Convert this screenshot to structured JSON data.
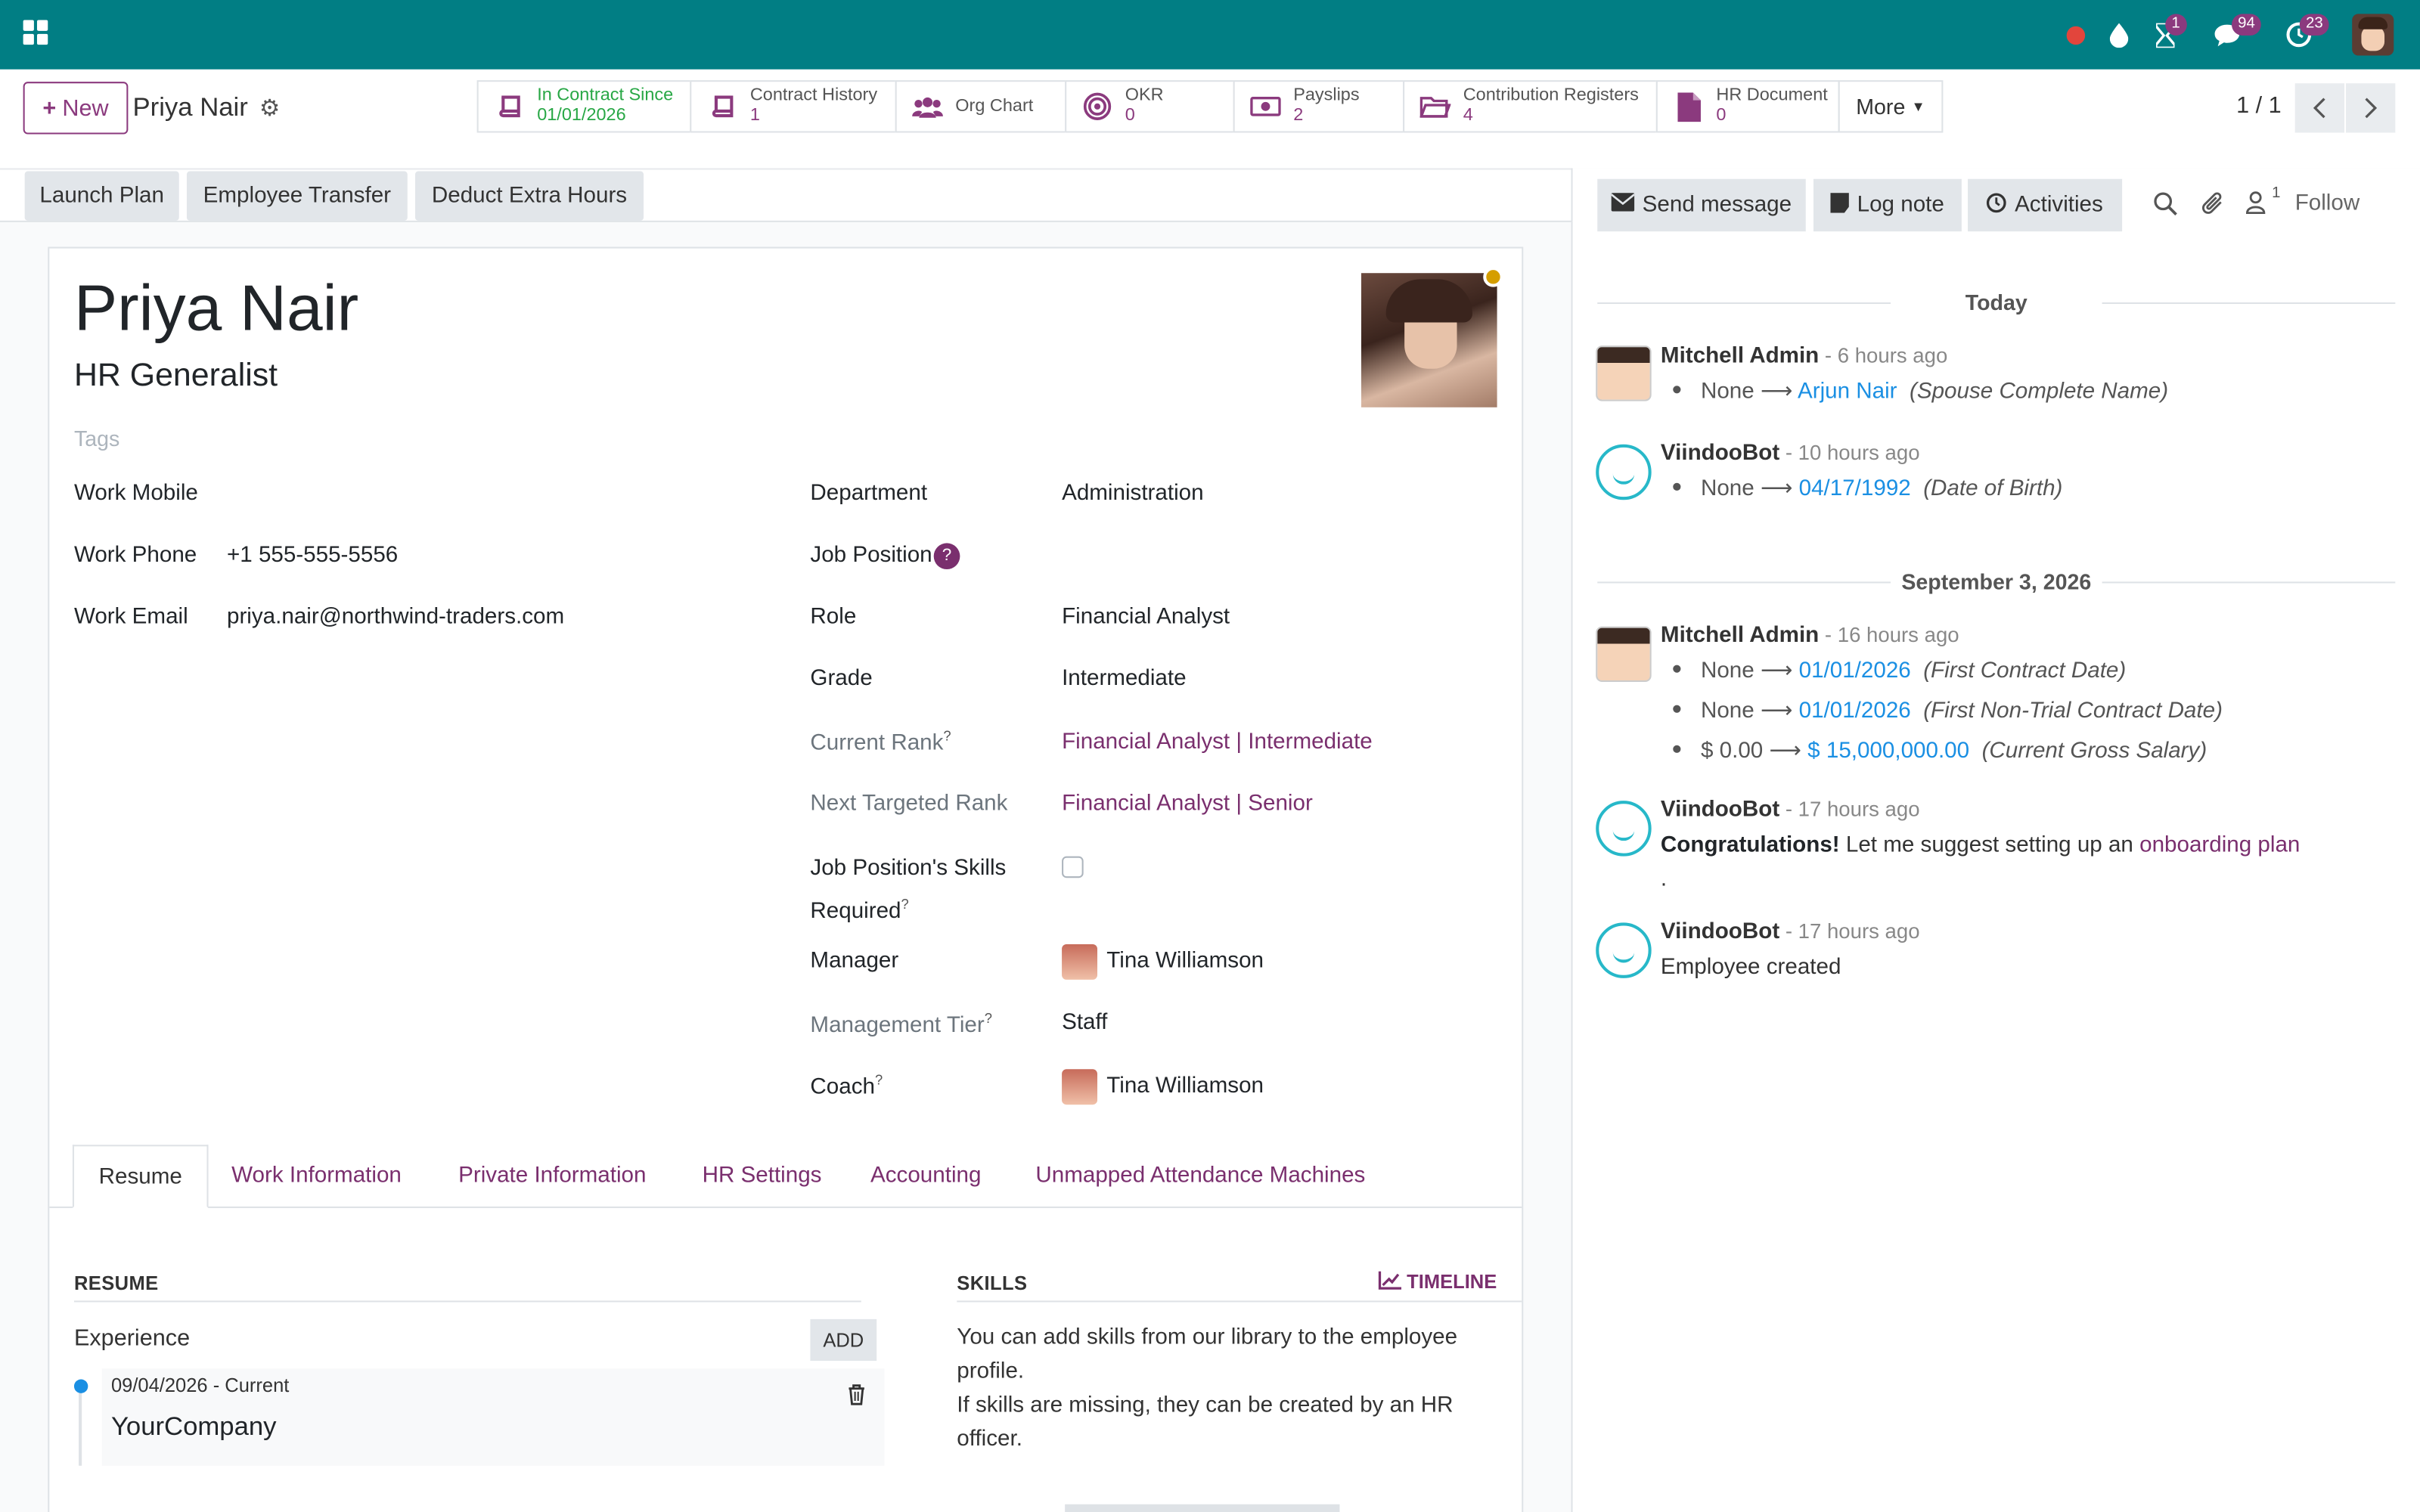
{
  "topbar": {
    "badges": {
      "activity": "1",
      "messages": "94",
      "clock": "23"
    }
  },
  "control": {
    "new_label": "New",
    "record_title": "Priya Nair",
    "smart_buttons": [
      {
        "label": "In Contract Since",
        "value": "01/01/2026",
        "icon": "book-icon"
      },
      {
        "label": "Contract History",
        "value": "1",
        "icon": "book-icon"
      },
      {
        "label": "Org Chart",
        "value": "",
        "icon": "users-icon"
      },
      {
        "label": "OKR",
        "value": "0",
        "icon": "target-icon"
      },
      {
        "label": "Payslips",
        "value": "2",
        "icon": "money-icon"
      },
      {
        "label": "Contribution Registers",
        "value": "4",
        "icon": "folder-icon"
      },
      {
        "label": "HR Document",
        "value": "0",
        "icon": "file-icon"
      }
    ],
    "more_label": "More",
    "pager": "1 / 1"
  },
  "actions": {
    "launch_plan": "Launch Plan",
    "employee_transfer": "Employee Transfer",
    "deduct_extra_hours": "Deduct Extra Hours"
  },
  "employee": {
    "name": "Priya Nair",
    "job_title": "HR Generalist",
    "tags_placeholder": "Tags",
    "work_mobile_label": "Work Mobile",
    "work_phone_label": "Work Phone",
    "work_phone": "+1 555-555-5556",
    "work_email_label": "Work Email",
    "work_email": "priya.nair@northwind-traders.com",
    "department_label": "Department",
    "department": "Administration",
    "job_position_label": "Job Position",
    "role_label": "Role",
    "role": "Financial Analyst",
    "grade_label": "Grade",
    "grade": "Intermediate",
    "current_rank_label": "Current Rank",
    "current_rank": "Financial Analyst | Intermediate",
    "next_rank_label": "Next Targeted Rank",
    "next_rank": "Financial Analyst | Senior",
    "skills_required_label_1": "Job Position's Skills",
    "skills_required_label_2": "Required",
    "manager_label": "Manager",
    "manager": "Tina Williamson",
    "mgmt_tier_label": "Management Tier",
    "mgmt_tier": "Staff",
    "coach_label": "Coach",
    "coach": "Tina Williamson"
  },
  "tabs": [
    "Resume",
    "Work Information",
    "Private Information",
    "HR Settings",
    "Accounting",
    "Unmapped Attendance Machines"
  ],
  "resume": {
    "heading": "RESUME",
    "experience_label": "Experience",
    "add_label": "ADD",
    "entry_date": "09/04/2026 - Current",
    "entry_company": "YourCompany"
  },
  "skills": {
    "heading": "SKILLS",
    "timeline_label": "TIMELINE",
    "text1": "You can add skills from our library to the employee profile.",
    "text2": "If skills are missing, they can be created by an HR officer."
  },
  "chatter": {
    "send_message": "Send message",
    "log_note": "Log note",
    "activities": "Activities",
    "followers_count": "1",
    "follow": "Follow",
    "sep_today": "Today",
    "sep_date": "September 3, 2026",
    "m1_author": "Mitchell Admin",
    "m1_time": " - 6 hours ago",
    "m1_old": "None",
    "m1_new": "Arjun Nair",
    "m1_field": "(Spouse Complete Name)",
    "m2_author": "ViindooBot",
    "m2_time": " - 10 hours ago",
    "m2_old": "None",
    "m2_new": "04/17/1992",
    "m2_field": "(Date of Birth)",
    "m3_author": "Mitchell Admin",
    "m3_time": " - 16 hours ago",
    "m3_rows": [
      {
        "old": "None",
        "new": "01/01/2026",
        "field": "(First Contract Date)"
      },
      {
        "old": "None",
        "new": "01/01/2026",
        "field": "(First Non-Trial Contract Date)"
      },
      {
        "old": "$ 0.00",
        "new": "$ 15,000,000.00",
        "field": "(Current Gross Salary)"
      }
    ],
    "m4_author": "ViindooBot",
    "m4_time": " - 17 hours ago",
    "m4_bold": "Congratulations!",
    "m4_text": " Let me suggest setting up an ",
    "m4_link": "onboarding plan",
    "m4_end": ".",
    "m5_author": "ViindooBot",
    "m5_time": " - 17 hours ago",
    "m5_text": "Employee created"
  }
}
